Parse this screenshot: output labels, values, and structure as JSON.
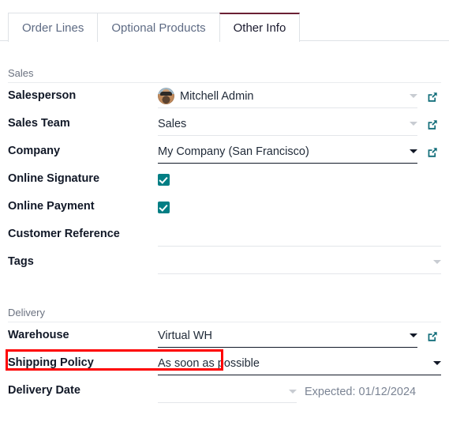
{
  "tabs": [
    {
      "label": "Order Lines",
      "active": false
    },
    {
      "label": "Optional Products",
      "active": false
    },
    {
      "label": "Other Info",
      "active": true
    }
  ],
  "sections": {
    "sales": {
      "title": "Sales",
      "fields": {
        "salesperson": {
          "label": "Salesperson",
          "value": "Mitchell Admin"
        },
        "sales_team": {
          "label": "Sales Team",
          "value": "Sales"
        },
        "company": {
          "label": "Company",
          "value": "My Company (San Francisco)"
        },
        "online_signature": {
          "label": "Online Signature",
          "checked": true
        },
        "online_payment": {
          "label": "Online Payment",
          "checked": true
        },
        "customer_reference": {
          "label": "Customer Reference",
          "value": ""
        },
        "tags": {
          "label": "Tags",
          "value": ""
        }
      }
    },
    "delivery": {
      "title": "Delivery",
      "fields": {
        "warehouse": {
          "label": "Warehouse",
          "value": "Virtual WH"
        },
        "shipping_policy": {
          "label": "Shipping Policy",
          "value": "As soon as possible"
        },
        "delivery_date": {
          "label": "Delivery Date",
          "value": "",
          "hint": "Expected: 01/12/2024"
        }
      }
    }
  },
  "icons": {
    "external_link": "external-link-icon",
    "dropdown_caret": "chevron-down-icon",
    "checkbox_check": "check-icon"
  },
  "colors": {
    "accent_teal": "#017e84",
    "active_tab_border": "#6b2034",
    "highlight_red": "#fe0000",
    "label_text": "#111827",
    "muted_text": "#6b7280"
  },
  "annotation": {
    "highlight_target": "Warehouse"
  }
}
